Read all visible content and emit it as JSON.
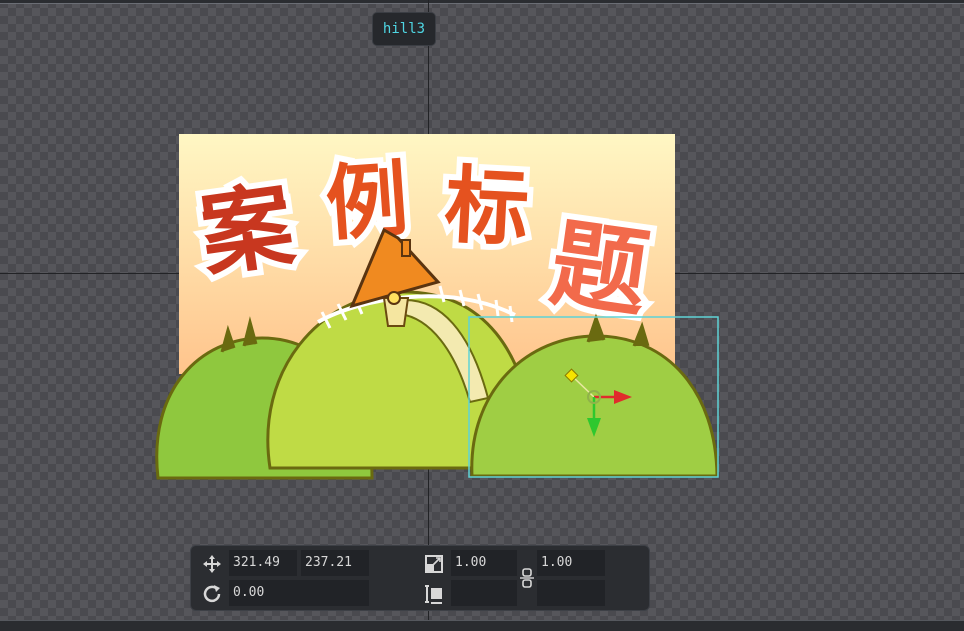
{
  "node": {
    "name": "hill3"
  },
  "scene": {
    "title_chars": [
      "案",
      "例",
      "标",
      "题"
    ]
  },
  "toolbar": {
    "position_x": "321.49",
    "position_y": "237.21",
    "rotation": "0.00",
    "scale_x": "1.00",
    "scale_y": "1.00",
    "size_w": "",
    "size_h": ""
  },
  "icons": {
    "move": "move-arrows-icon",
    "rotate": "rotate-icon",
    "scale": "scale-icon",
    "size": "size-icon",
    "link": "link-chain-icon"
  },
  "colors": {
    "selection": "#5fd3d6",
    "tag_text": "#4fd6e3",
    "gizmo_x": "#e02c2c",
    "gizmo_y": "#2ec82e",
    "gizmo_pivot": "#f5e400"
  }
}
